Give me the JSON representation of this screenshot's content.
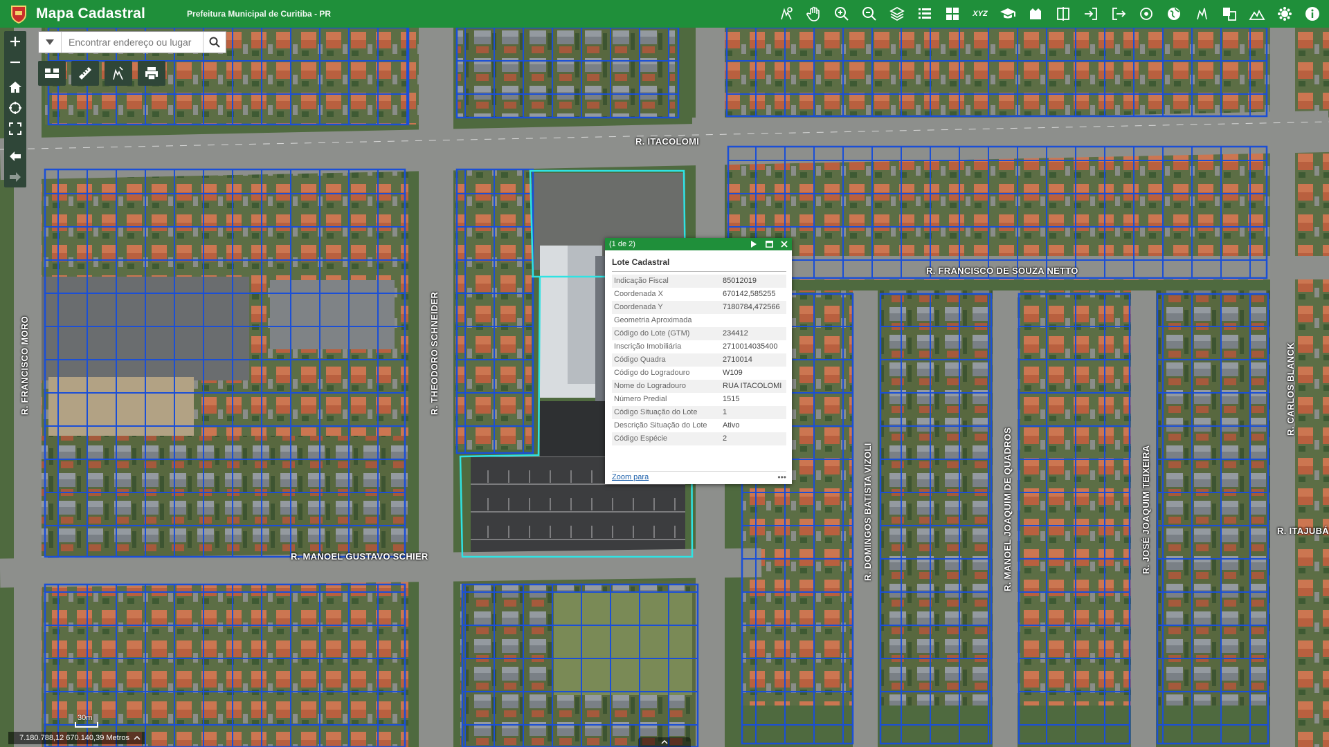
{
  "header": {
    "title": "Mapa Cadastral",
    "subtitle": "Prefeitura Municipal de Curitiba - PR",
    "tools": [
      "identify-icon",
      "pan-hand-icon",
      "zoom-in-icon",
      "zoom-out-icon",
      "layers-icon",
      "list-icon",
      "basemap-grid-icon",
      "xyz-coordinates-icon",
      "education-icon",
      "report-icon",
      "split-view-icon",
      "login-icon",
      "logout-icon",
      "locate-icon",
      "globe-icon",
      "measure-icon",
      "compare-icon",
      "profile-icon",
      "settings-icon",
      "info-icon"
    ],
    "xyz_label": "XYZ"
  },
  "search": {
    "placeholder": "Encontrar endereço ou lugar"
  },
  "map": {
    "colors": {
      "lot_outline": "#1b4fd6",
      "selected_lot": "#2fe3e3",
      "street": "#8d8f8c",
      "header_green": "#1f8f3a"
    },
    "streets": {
      "itacolomi": "R. ITACOLOMI",
      "francisco_souza_netto": "R. FRANCISCO DE SOUZA NETTO",
      "manoel_gustavo_schier": "R. MANOEL GUSTAVO SCHIER",
      "francisco_moro": "R. FRANCISCO MORO",
      "theodoro_schneider": "R. THEODORO SCHNEIDER",
      "domingos_batista_vizoli": "R. DOMINGOS BATISTA VIZOLI",
      "manoel_joaquim_quadros": "R. MANOEL JOAQUIM DE QUADROS",
      "jose_joaquim_teixeira": "R. JOSÉ JOAQUIM TEIXEIRA",
      "carlos_blanck": "R. CARLOS BLANCK",
      "itajuba": "R. ITAJUBÁ"
    }
  },
  "popup": {
    "count": "(1 de 2)",
    "title": "Lote Cadastral",
    "rows": [
      {
        "k": "Indicação Fiscal",
        "v": "85012019"
      },
      {
        "k": "Coordenada X",
        "v": "670142,585255"
      },
      {
        "k": "Coordenada Y",
        "v": "7180784,472566"
      },
      {
        "k": "Geometria Aproximada",
        "v": ""
      },
      {
        "k": "Código do Lote (GTM)",
        "v": "234412"
      },
      {
        "k": "Inscrição Imobiliária",
        "v": "2710014035400"
      },
      {
        "k": "Código Quadra",
        "v": "2710014"
      },
      {
        "k": "Código do Logradouro",
        "v": "W109"
      },
      {
        "k": "Nome do Logradouro",
        "v": "RUA ITACOLOMI"
      },
      {
        "k": "Número Predial",
        "v": "1515"
      },
      {
        "k": "Código Situação do Lote",
        "v": "1"
      },
      {
        "k": "Descrição Situação do Lote",
        "v": "Ativo"
      },
      {
        "k": "Código Espécie",
        "v": "2"
      }
    ],
    "zoom_link": "Zoom para",
    "more": "•••"
  },
  "status": {
    "coords": "7.180.788,12 670.140,39 Metros",
    "scale": "30m"
  }
}
